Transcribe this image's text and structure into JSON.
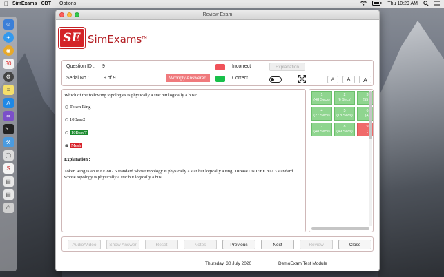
{
  "menubar": {
    "app_name": "SimExams : CBT",
    "menus": [
      "Options"
    ],
    "clock": "Thu 10:29 AM"
  },
  "window": {
    "title": "Review Exam"
  },
  "logo": {
    "badge": "SE",
    "name": "SimExams",
    "tm": "TM"
  },
  "info": {
    "question_id_label": "Question ID :",
    "question_id_value": "9",
    "serial_label": "Serial No :",
    "serial_value": "9 of 9",
    "status_badge": "Wrongly Answered",
    "incorrect_label": "Incorrect",
    "correct_label": "Correct",
    "incorrect_color": "#f0525a",
    "correct_color": "#18c04a",
    "explanation_button": "Explanation",
    "font_buttons": [
      "A",
      "A",
      "A"
    ]
  },
  "question": {
    "text": "Which of the following topologies is physically a star but logically a bus?",
    "options": [
      "Token Ring",
      "10Base2",
      "10BaseT",
      "Mesh"
    ],
    "correct_option_color": "#1b8a2e",
    "selected_wrong_color": "#d8222a",
    "explanation_heading": "Explanation :",
    "explanation_text": "Token Ring is an IEEE 802.5 standard whose topology is physically a star but logically a ring. 10BaseT is IEEE 802.3 standard whose topology is physically a star but logically a bus."
  },
  "question_grid": [
    {
      "num": "1",
      "time": "(48 Secs)",
      "state": "answered"
    },
    {
      "num": "2",
      "time": "(6 Secs)",
      "state": "answered"
    },
    {
      "num": "3",
      "time": "(55 S",
      "state": "answered"
    },
    {
      "num": "4",
      "time": "(27 Secs)",
      "state": "answered"
    },
    {
      "num": "5",
      "time": "(18 Secs)",
      "state": "answered"
    },
    {
      "num": "6",
      "time": "(4)",
      "state": "answered"
    },
    {
      "num": "7",
      "time": "(48 Secs)",
      "state": "answered"
    },
    {
      "num": "8",
      "time": "(49 Secs)",
      "state": "answered"
    },
    {
      "num": "9",
      "time": "(",
      "state": "wrong"
    }
  ],
  "buttons": {
    "audio_video": "Audio/Video",
    "show_answer": "Show Answer",
    "reset": "Reset",
    "notes": "Notes",
    "previous": "Previous",
    "next": "Next",
    "review": "Review",
    "close": "Close"
  },
  "footer": {
    "date": "Thursday, 30 July 2020",
    "module": "DemoExam Test Module"
  }
}
